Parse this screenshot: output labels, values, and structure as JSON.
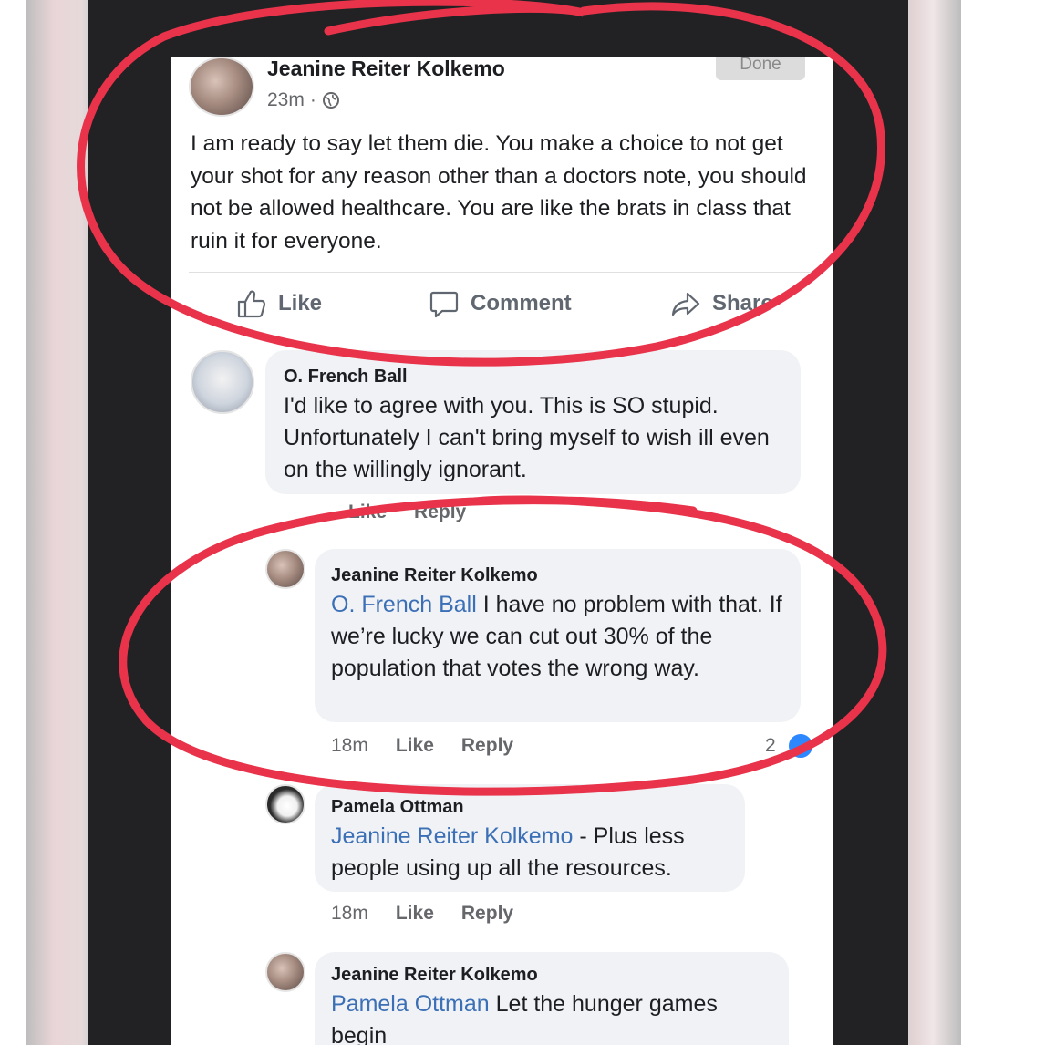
{
  "post": {
    "author": "Jeanine Reiter Kolkemo",
    "time": "23m",
    "separator": "·",
    "done_label": "Done",
    "text": "I am ready to say let them die.  You make a choice to not get your shot for any reason other than a doctors note, you should not be allowed healthcare. You are like the brats in class that ruin it for everyone.",
    "actions": {
      "like": "Like",
      "comment": "Comment",
      "share": "Share"
    }
  },
  "comments": [
    {
      "author": "O. French Ball",
      "text": "I'd like to agree with you. This is SO stupid. Unfortunately I can't bring myself to wish ill even on the willingly ignorant.",
      "like": "Like",
      "reply": "Reply"
    },
    {
      "author": "Jeanine Reiter Kolkemo",
      "mention": "O. French Ball",
      "text": " I have no problem with that. If we’re lucky we can cut out 30% of the population that votes the wrong way.",
      "time": "18m",
      "like": "Like",
      "reply": "Reply",
      "reaction_count": "2"
    },
    {
      "author": "Pamela Ottman",
      "mention": "Jeanine Reiter Kolkemo",
      "text": " - Plus less people using up all the resources.",
      "time": "18m",
      "like": "Like",
      "reply": "Reply"
    },
    {
      "author": "Jeanine Reiter Kolkemo",
      "mention": "Pamela Ottman",
      "text": " Let the hunger games begin"
    }
  ],
  "colors": {
    "annotation_red": "#e8334a",
    "mention_blue": "#3b6fb6",
    "bubble_gray": "#f0f2f5"
  }
}
